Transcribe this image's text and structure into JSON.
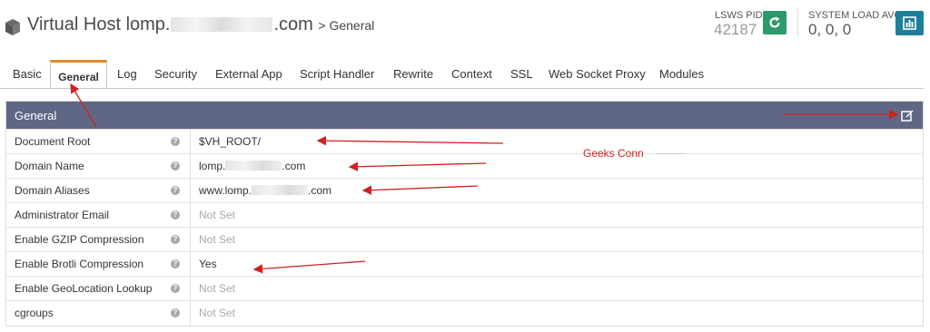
{
  "header": {
    "title_prefix": "Virtual Host lomp.",
    "title_domain_suffix": ".com",
    "breadcrumb": "> General",
    "pid_label": "LSWS PID",
    "pid_value": "42187",
    "load_label": "SYSTEM LOAD AVG",
    "load_value": "0, 0, 0",
    "restart_icon": "refresh-icon",
    "stats_icon": "bar-chart-icon"
  },
  "tabs": [
    "Basic",
    "General",
    "Log",
    "Security",
    "External App",
    "Script Handler",
    "Rewrite",
    "Context",
    "SSL",
    "Web Socket Proxy",
    "Modules"
  ],
  "active_tab": "General",
  "panel": {
    "title": "General",
    "edit_icon": "edit-icon",
    "rows": [
      {
        "label": "Document Root",
        "value": "$VH_ROOT/"
      },
      {
        "label": "Domain Name",
        "value_prefix": "lomp.",
        "value_suffix": ".com"
      },
      {
        "label": "Domain Aliases",
        "value_prefix": "www.lomp.",
        "value_suffix": ".com"
      },
      {
        "label": "Administrator Email",
        "value": "Not Set"
      },
      {
        "label": "Enable GZIP Compression",
        "value": "Not Set"
      },
      {
        "label": "Enable Brotli Compression",
        "value": "Yes"
      },
      {
        "label": "Enable GeoLocation Lookup",
        "value": "Not Set"
      },
      {
        "label": "cgroups",
        "value": "Not Set"
      }
    ]
  },
  "watermark": "Geeks Conn",
  "colors": {
    "panel_header": "#5f6784",
    "active_tab_border": "#e08a2e",
    "restart_button": "#2d9a6c",
    "stats_button": "#1e7e9a",
    "annotation_arrow": "#d02020"
  }
}
